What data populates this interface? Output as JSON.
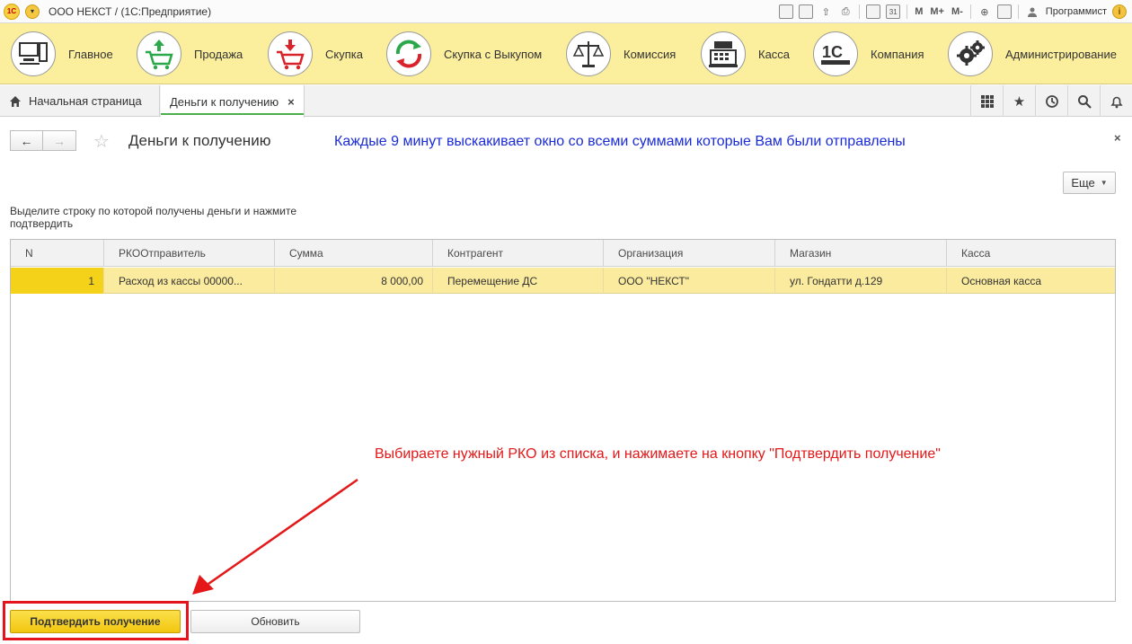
{
  "titlebar": {
    "app_title": "ООО НЕКСТ /   (1С:Предприятие)",
    "logo_icon": "1c-logo-icon",
    "logo_text": "1С",
    "menu_icon": "chevron-down-icon",
    "m_label": "M",
    "m_plus_label": "M+",
    "m_minus_label": "M-",
    "user": "Программист",
    "info_glyph": "i"
  },
  "sections": [
    {
      "label": "Главное",
      "icon": "computer-icon"
    },
    {
      "label": "Продажа",
      "icon": "cart-up-icon"
    },
    {
      "label": "Скупка",
      "icon": "cart-down-icon"
    },
    {
      "label": "Скупка с Выкупом",
      "icon": "cycle-arrows-icon"
    },
    {
      "label": "Комиссия",
      "icon": "scales-icon"
    },
    {
      "label": "Касса",
      "icon": "cash-register-icon"
    },
    {
      "label": "Компания",
      "icon": "1c-company-icon"
    },
    {
      "label": "Администрирование",
      "icon": "gears-icon"
    }
  ],
  "tabs": {
    "home": "Начальная страница",
    "active": "Деньги к получению",
    "close_glyph": "×"
  },
  "form": {
    "title": "Деньги к получению",
    "back_glyph": "←",
    "forward_glyph": "→",
    "star_glyph": "☆",
    "close_glyph": "×",
    "more_label": "Еще",
    "more_caret": "▼",
    "instruction": "Выделите строку по которой получены деньги и нажмите подтвердить"
  },
  "notes": {
    "blue": "Каждые 9 минут выскакивает окно со всеми суммами которые Вам были отправлены",
    "red": "Выбираете нужный РКО из списка, и нажимаете на кнопку \"Подтвердить получение\""
  },
  "table": {
    "headers": [
      "N",
      "РКООтправитель",
      "Сумма",
      "Контрагент",
      "Организация",
      "Магазин",
      "Касса"
    ],
    "rows": [
      [
        "1",
        "Расход из кассы 00000...",
        "8 000,00",
        "Перемещение ДС",
        "ООО \"НЕКСТ\"",
        "ул. Гондатти д.129",
        "Основная касса"
      ]
    ]
  },
  "buttons": {
    "confirm": "Подтвердить получение",
    "refresh": "Обновить"
  },
  "colors": {
    "section_bg": "#fbee9d",
    "selected_row": "#fbeb9e",
    "accent_yellow": "#f5d21a",
    "annotation_red": "#e41818",
    "annotation_blue": "#1a2bd8"
  }
}
